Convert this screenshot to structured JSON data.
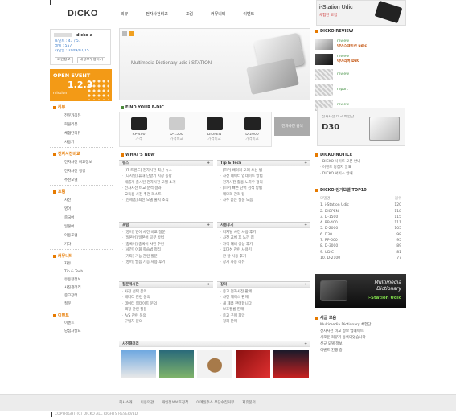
{
  "header": {
    "logo": "DiCKO",
    "nav": [
      "리뷰",
      "전자사전비교",
      "포럼",
      "커뮤니티",
      "이벤트"
    ],
    "ad_title": "i-Station Udic",
    "ad_sub": "체험단 모집"
  },
  "login": {
    "user": "dicko a",
    "stats": [
      "포인트 : 47 / 57",
      "레벨 : 557",
      "가입일 : 2009/07/15"
    ],
    "buttons": [
      "회원정보",
      "내정보수정하기"
    ]
  },
  "promo": {
    "title": "OPEN EVENT",
    "sub": "mission",
    "nums": "1.2.3"
  },
  "sidebar": {
    "groups": [
      {
        "title": "리뷰",
        "items": [
          "전문가리뷰",
          "회원리뷰",
          "체험단리뷰",
          "사용기"
        ]
      },
      {
        "title": "전자사전비교",
        "items": [
          "전자사전 비교정보",
          "전자사전 랭킹",
          "추천모델"
        ]
      },
      {
        "title": "포럼",
        "items": [
          "사전",
          "영어",
          "중국어",
          "일본어",
          "이용포럼",
          "기타"
        ]
      },
      {
        "title": "커뮤니티",
        "items": [
          "자유",
          "Tip & Tech",
          "유용한정보",
          "사진갤러리",
          "중고장터",
          "질문"
        ]
      },
      {
        "title": "이벤트",
        "items": [
          "이벤트",
          "당첨자발표"
        ]
      }
    ]
  },
  "banner": {
    "text": "Multimedia Dictionary udic i-STATION"
  },
  "find": {
    "title": "FIND YOUR E-DIC",
    "devices": [
      {
        "name": "RP-400",
        "price": "가격"
      },
      {
        "name": "D-1500",
        "price": "가격비교"
      },
      {
        "name": "DIOPEN",
        "price": "가격비교"
      },
      {
        "name": "D-2000",
        "price": "가격비교"
      }
    ],
    "search_label": "전자사전 검색"
  },
  "whats_new": {
    "title": "WHAT'S NEW",
    "panels": [
      {
        "title": "뉴스",
        "items": [
          "[IT 트렌드] 전자사전 최신 뉴스",
          "[디지털] 휴대 단말기 시장 동향",
          "새롭게 출시된 전자사전 모델 소개",
          "전자사전 비교 분석 결과",
          "교육용 사전 추천 리스트",
          "[신제품] 최신 모델 출시 소식"
        ]
      },
      {
        "title": "Tip & Tech",
        "items": [
          "[TIP] 배터리 오래 쓰는 법",
          "사전 데이터 업데이트 방법",
          "전자사전 활용 노하우 정리",
          "[TIP] 빠른 단어 검색 방법",
          "메모리 관리 팁",
          "자주 묻는 질문 모음"
        ]
      },
      {
        "title": "포럼",
        "items": [
          "[영어] 영어 사전 비교 질문",
          "[일본어] 일본어 공부 방법",
          "[중국어] 중국어 사전 추천",
          "[사전] 어휘 학습법 정리",
          "[기타] 기능 관련 질문",
          "[영어] 발음 기능 사용 후기"
        ]
      },
      {
        "title": "사용후기",
        "items": [
          "디지털 사전 사용 후기",
          "사전 교체 후 느낀 점",
          "가격 대비 성능 후기",
          "휴대성 관련 사용기",
          "한 달 사용 후기",
          "장기 사용 리뷰"
        ]
      },
      {
        "title": "질문게시판",
        "items": [
          "사전 선택 문의",
          "배터리 관련 문의",
          "데이터 업데이트 문의",
          "액정 관련 질문",
          "A/S 관련 문의",
          "구입처 문의"
        ]
      },
      {
        "title": "장터",
        "items": [
          "중고 전자사전 판매",
          "사전 케이스 판매",
          "새 제품 판매합니다",
          "보호필름 판매",
          "중고 구매 희망",
          "정리 판매"
        ]
      }
    ],
    "gallery_title": "사진갤러리"
  },
  "right": {
    "review_title": "DICKO REVIEW",
    "reviews": [
      {
        "cat": "review",
        "title": "아이스테이션 udic"
      },
      {
        "cat": "review",
        "title": "아이리버 D30"
      },
      {
        "cat": "review",
        "title": ""
      },
      {
        "cat": "report",
        "title": ""
      },
      {
        "cat": "review",
        "title": ""
      }
    ],
    "ad_small": "전자사전 비교 체험단",
    "ad_model": "D30",
    "notice_title": "DICKO NOTICE",
    "notices": [
      "DICKO 사이트 오픈 안내",
      "이벤트 당첨자 발표",
      "DICKO 서비스 안내"
    ],
    "top10_title": "DICKO 인기모델 TOP10",
    "top10_header": [
      "모델명",
      "점수"
    ],
    "top10": [
      [
        "i-Station Udic",
        "120"
      ],
      [
        "DIOPEN",
        "118"
      ],
      [
        "D-1500",
        "115"
      ],
      [
        "RP-400",
        "111"
      ],
      [
        "D-2000",
        "105"
      ],
      [
        "D30",
        "98"
      ],
      [
        "RP-500",
        "95"
      ],
      [
        "D-3000",
        "89"
      ],
      [
        "UDIC",
        "81"
      ],
      [
        "D-2100",
        "77"
      ]
    ],
    "ad2_line1": "Multimedia",
    "ad2_line2": "Dictionary",
    "ad2_brand": "i-Station Udic",
    "cmt_title": "새글 모음",
    "cmts": [
      "Multimedia Dictionary 체험단",
      "전자사전 비교 정보 업데이트",
      "새로운 리뷰가 등록되었습니다",
      "신규 모델 정보",
      "이벤트 진행 중"
    ]
  },
  "footer": {
    "links": [
      "회사소개",
      "이용약관",
      "개인정보보호정책",
      "이메일주소 무단수집거부",
      "제휴문의"
    ],
    "copy": "COPYRIGHT (C) DICKO ALL RIGHTS RESERVED"
  }
}
